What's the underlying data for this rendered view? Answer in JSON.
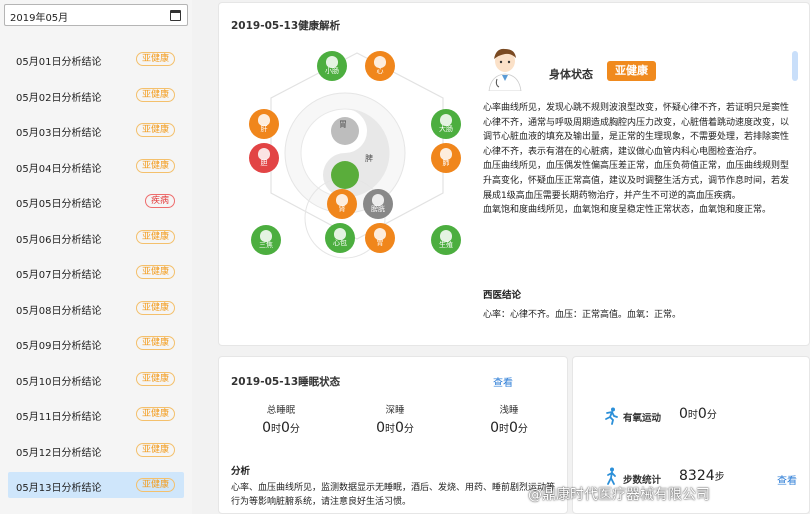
{
  "sidebar": {
    "month_value": "2019年05月",
    "days": [
      {
        "label": "05月01日分析结论",
        "badge": "亚健康",
        "type": "warn"
      },
      {
        "label": "05月02日分析结论",
        "badge": "亚健康",
        "type": "warn"
      },
      {
        "label": "05月03日分析结论",
        "badge": "亚健康",
        "type": "warn"
      },
      {
        "label": "05月04日分析结论",
        "badge": "亚健康",
        "type": "warn"
      },
      {
        "label": "05月05日分析结论",
        "badge": "疾病",
        "type": "sick"
      },
      {
        "label": "05月06日分析结论",
        "badge": "亚健康",
        "type": "warn"
      },
      {
        "label": "05月07日分析结论",
        "badge": "亚健康",
        "type": "warn"
      },
      {
        "label": "05月08日分析结论",
        "badge": "亚健康",
        "type": "warn"
      },
      {
        "label": "05月09日分析结论",
        "badge": "亚健康",
        "type": "warn"
      },
      {
        "label": "05月10日分析结论",
        "badge": "亚健康",
        "type": "warn"
      },
      {
        "label": "05月11日分析结论",
        "badge": "亚健康",
        "type": "warn"
      },
      {
        "label": "05月12日分析结论",
        "badge": "亚健康",
        "type": "warn"
      },
      {
        "label": "05月13日分析结论",
        "badge": "亚健康",
        "type": "warn",
        "active": true
      }
    ]
  },
  "health": {
    "title": "2019-05-13健康解析",
    "center_labels": {
      "stomach": "胃",
      "spleen": "脾"
    },
    "organs": {
      "small_intestine": "小肠",
      "heart": "心",
      "liver": "肝",
      "large_intestine": "大肠",
      "gallbladder": "胆",
      "lung": "肺",
      "stomach": "胃",
      "kidney": "肾",
      "bladder": "膀胱",
      "pericardium": "心包",
      "triple_burner": "三焦",
      "reproduction": "生殖"
    },
    "body_status_label": "身体状态",
    "body_status_value": "亚健康",
    "analysis": [
      "心率曲线所见，发现心跳不规则波浪型改变，怀疑心律不齐，若证明只是窦性心律不齐，通常与呼吸周期造成胸腔内压力改变，心脏借着跳动速度改变，以调节心脏血液的填充及输出量，是正常的生理现象，不需要处理，若排除窦性心律不齐，表示有潜在的心脏病，建议做心血管内科心电图检查治疗。",
      "血压曲线所见，血压偶发性偏高压差正常，血压负荷值正常，血压曲线规则型升高变化，怀疑血压正常高值，建议及时调整生活方式，调节作息时间，若发展成1级高血压需要长期药物治疗，并产生不可逆的高血压疾病。",
      "血氧饱和度曲线所见，血氧饱和度呈稳定性正常状态，血氧饱和度正常。"
    ],
    "western_title": "西医结论",
    "western_text": "心率：心律不齐。血压：正常高值。血氧：正常。"
  },
  "sleep": {
    "title": "2019-05-13睡眠状态",
    "view_label": "查看",
    "total": {
      "label": "总睡眠",
      "h": "0",
      "h_unit": "时",
      "m": "0",
      "m_unit": "分"
    },
    "deep": {
      "label": "深睡",
      "h": "0",
      "h_unit": "时",
      "m": "0",
      "m_unit": "分"
    },
    "light": {
      "label": "浅睡",
      "h": "0",
      "h_unit": "时",
      "m": "0",
      "m_unit": "分"
    },
    "analysis_title": "分析",
    "analysis_text": "心率、血压曲线所见，监测数据显示无睡眠，酒后、发烧、用药、睡前剧烈运动等行为等影响脏腑系统，请注意良好生活习惯。"
  },
  "activity": {
    "aerobic_label": "有氧运动",
    "aerobic_h": "0",
    "aerobic_h_unit": "时",
    "aerobic_m": "0",
    "aerobic_m_unit": "分",
    "steps_label": "步数统计",
    "steps_value": "8324",
    "steps_unit": "步",
    "view_label": "查看"
  },
  "watermark": "@鼎康时代医疗器械有限公司"
}
